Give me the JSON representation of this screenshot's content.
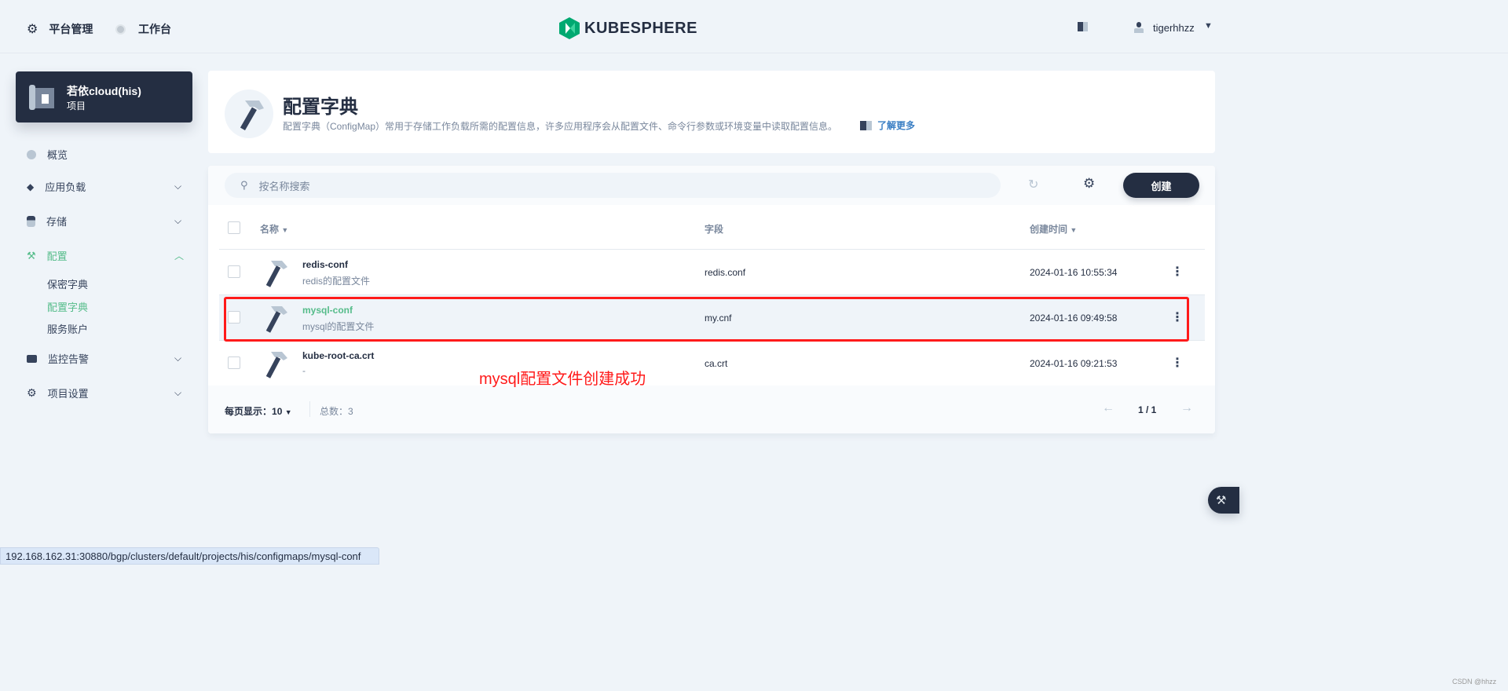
{
  "header": {
    "platform": "平台管理",
    "workbench": "工作台",
    "logo": "KUBESPHERE",
    "user": "tigerhhzz"
  },
  "project": {
    "name": "若依cloud(his)",
    "type": "项目"
  },
  "sidebar": {
    "items": [
      {
        "label": "概览"
      },
      {
        "label": "应用负载"
      },
      {
        "label": "存储"
      },
      {
        "label": "配置"
      },
      {
        "label": "监控告警"
      },
      {
        "label": "项目设置"
      }
    ],
    "sub": [
      {
        "label": "保密字典"
      },
      {
        "label": "配置字典"
      },
      {
        "label": "服务账户"
      }
    ]
  },
  "banner": {
    "title": "配置字典",
    "desc": "配置字典（ConfigMap）常用于存储工作负载所需的配置信息，许多应用程序会从配置文件、命令行参数或环境变量中读取配置信息。",
    "learn_more": "了解更多"
  },
  "toolbar": {
    "search_placeholder": "按名称搜索",
    "create": "创建"
  },
  "table": {
    "headers": [
      "名称",
      "字段",
      "创建时间"
    ],
    "rows": [
      {
        "name": "redis-conf",
        "desc": "redis的配置文件",
        "field": "redis.conf",
        "time": "2024-01-16 10:55:34"
      },
      {
        "name": "mysql-conf",
        "desc": "mysql的配置文件",
        "field": "my.cnf",
        "time": "2024-01-16 09:49:58"
      },
      {
        "name": "kube-root-ca.crt",
        "desc": "-",
        "field": "ca.crt",
        "time": "2024-01-16 09:21:53"
      }
    ]
  },
  "pagination": {
    "per_page_label": "每页显示：",
    "per_page": "10",
    "total": "总数：3",
    "page": "1 / 1"
  },
  "annotation": "mysql配置文件创建成功",
  "status_url": "192.168.162.31:30880/bgp/clusters/default/projects/his/configmaps/mysql-conf",
  "watermark": "CSDN @hhzz",
  "colors": {
    "accent": "#55bc8a",
    "dark": "#242e42",
    "highlight": "#ff1a1a",
    "link": "#3385ff"
  }
}
